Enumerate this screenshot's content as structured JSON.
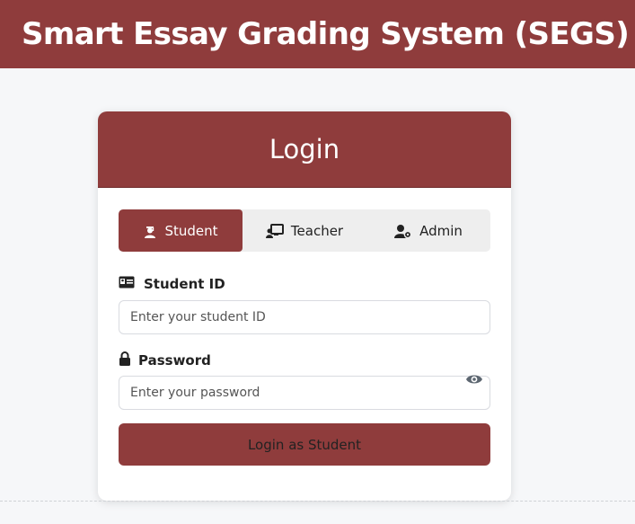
{
  "app": {
    "title": "Smart Essay Grading System (SEGS)"
  },
  "login": {
    "heading": "Login",
    "tabs": [
      {
        "label": "Student",
        "icon": "graduate-icon",
        "active": true
      },
      {
        "label": "Teacher",
        "icon": "teacher-icon",
        "active": false
      },
      {
        "label": "Admin",
        "icon": "admin-icon",
        "active": false
      }
    ],
    "student_id": {
      "label": "Student ID",
      "placeholder": "Enter your student ID",
      "value": ""
    },
    "password": {
      "label": "Password",
      "placeholder": "Enter your password",
      "value": ""
    },
    "submit_label": "Login as Student"
  },
  "colors": {
    "brand": "#8f3c3c",
    "background": "#f6f7f9",
    "tab_bg": "#eeeeee"
  }
}
